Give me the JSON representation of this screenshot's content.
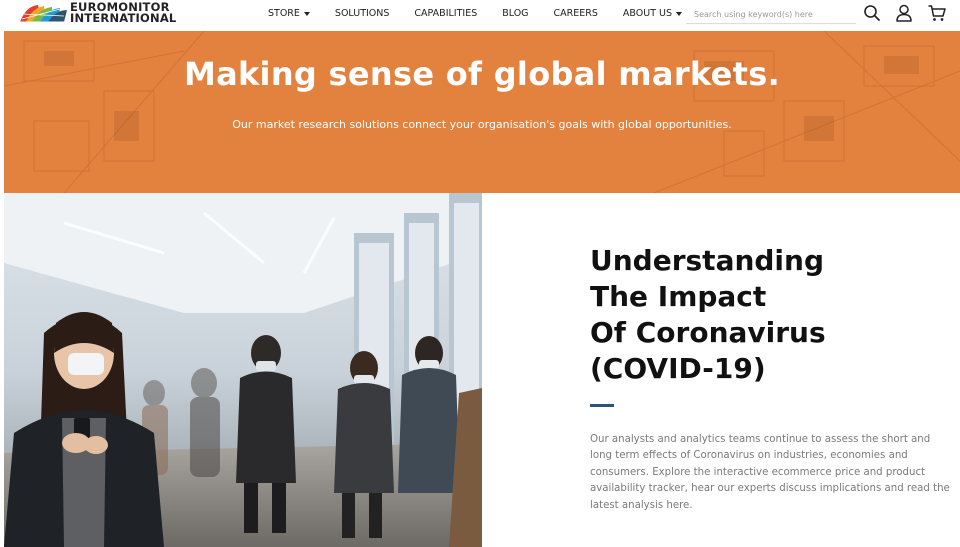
{
  "brand": {
    "line1": "EUROMONITOR",
    "line2": "INTERNATIONAL"
  },
  "nav": {
    "items": [
      {
        "label": "STORE",
        "dropdown": true
      },
      {
        "label": "SOLUTIONS",
        "dropdown": false
      },
      {
        "label": "CAPABILITIES",
        "dropdown": false
      },
      {
        "label": "BLOG",
        "dropdown": false
      },
      {
        "label": "CAREERS",
        "dropdown": false
      },
      {
        "label": "ABOUT US",
        "dropdown": true
      }
    ],
    "search_placeholder": "Search using keyword(s) here",
    "icons": [
      "search-icon",
      "user-icon",
      "cart-icon"
    ]
  },
  "hero": {
    "title": "Making sense of global markets.",
    "subtitle": "Our market research solutions connect your organisation's goals with global opportunities.",
    "color": "#e3813f"
  },
  "article": {
    "title_lines": [
      "Understanding",
      "The Impact",
      "Of Coronavirus",
      "(COVID-19)"
    ],
    "body": "Our analysts and analytics teams continue to assess the short and long term effects of Coronavirus on industries, economies and consumers. Explore the interactive ecommerce price and product availability tracker, hear our experts discuss implications and read the latest analysis here.",
    "accent_color": "#2d5470"
  }
}
